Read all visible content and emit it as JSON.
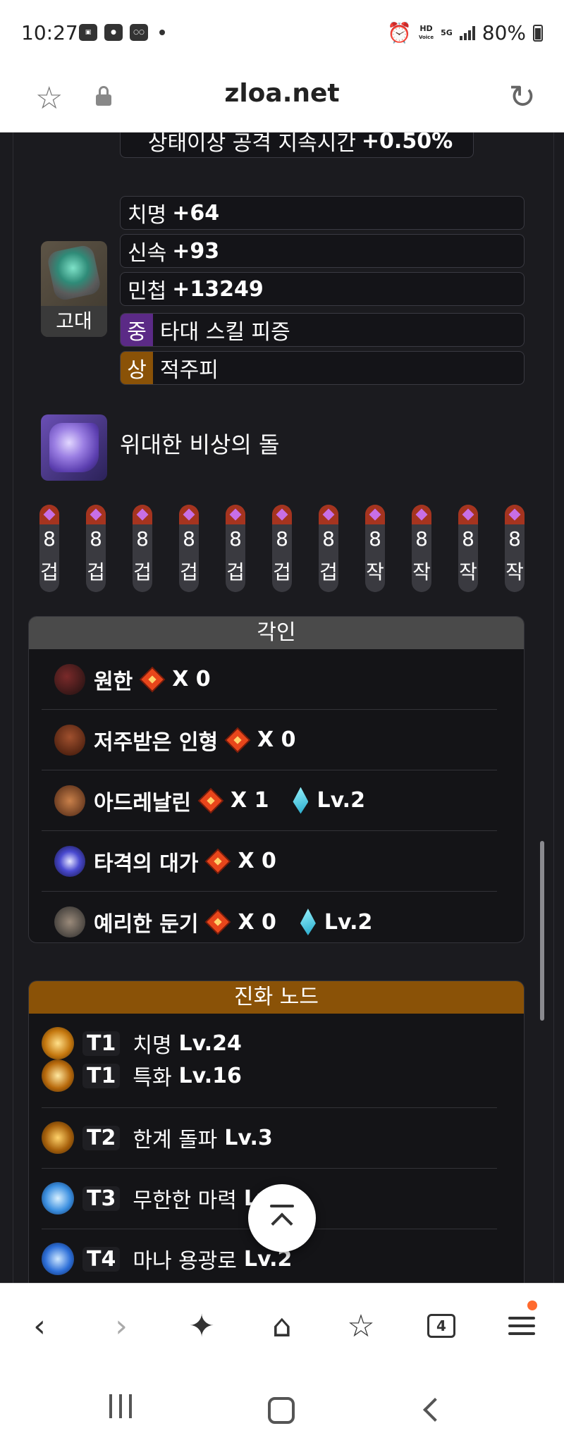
{
  "status_bar": {
    "time": "10:27",
    "battery": "80%",
    "hd_label": "HD",
    "voice_label": "Voice",
    "net_label": "5G"
  },
  "browser": {
    "domain": "zloa.net"
  },
  "top_partial": {
    "effect_label": "상태이상 공격 지속시간",
    "effect_value": "+0.50%"
  },
  "accessory": {
    "grade_label": "고대",
    "stats": [
      {
        "name": "치명",
        "value": "+64"
      },
      {
        "name": "신속",
        "value": "+93"
      },
      {
        "name": "민첩",
        "value": "+13249"
      }
    ],
    "options": [
      {
        "grade": "중",
        "text": "타대 스킬 피증",
        "color": "#5b2a86"
      },
      {
        "grade": "상",
        "text": "적주피",
        "color": "#8a5207"
      }
    ]
  },
  "ability_stone": {
    "name": "위대한 비상의 돌"
  },
  "gems": [
    {
      "level": "8",
      "kind": "겁"
    },
    {
      "level": "8",
      "kind": "겁"
    },
    {
      "level": "8",
      "kind": "겁"
    },
    {
      "level": "8",
      "kind": "겁"
    },
    {
      "level": "8",
      "kind": "겁"
    },
    {
      "level": "8",
      "kind": "겁"
    },
    {
      "level": "8",
      "kind": "겁"
    },
    {
      "level": "8",
      "kind": "작"
    },
    {
      "level": "8",
      "kind": "작"
    },
    {
      "level": "8",
      "kind": "작"
    },
    {
      "level": "8",
      "kind": "작"
    }
  ],
  "engravings": {
    "title": "각인",
    "items": [
      {
        "name": "원한",
        "count": "X 0",
        "stone_level": ""
      },
      {
        "name": "저주받은 인형",
        "count": "X 0",
        "stone_level": ""
      },
      {
        "name": "아드레날린",
        "count": "X 1",
        "stone_level": "Lv.2"
      },
      {
        "name": "타격의 대가",
        "count": "X 0",
        "stone_level": ""
      },
      {
        "name": "예리한 둔기",
        "count": "X 0",
        "stone_level": "Lv.2"
      }
    ]
  },
  "evolution": {
    "title": "진화 노드",
    "rows": [
      {
        "lines": [
          {
            "tier": "T1",
            "name": "치명",
            "level": "Lv.24"
          },
          {
            "tier": "T1",
            "name": "특화",
            "level": "Lv.16"
          }
        ]
      },
      {
        "lines": [
          {
            "tier": "T2",
            "name": "한계 돌파",
            "level": "Lv.3"
          }
        ]
      },
      {
        "lines": [
          {
            "tier": "T3",
            "name": "무한한 마력",
            "level": "Lv."
          }
        ]
      },
      {
        "lines": [
          {
            "tier": "T4",
            "name": "마나 용광로",
            "level": "Lv.2"
          }
        ]
      }
    ]
  },
  "toolbar": {
    "tab_count": "4"
  },
  "colors": {
    "background": "#1b1b1f",
    "engraving_header": "#4a4a4a",
    "evolution_header": "#8a5207",
    "relic": "#e8461b",
    "gem_top": "#a5341f"
  },
  "icons": [
    "star-icon",
    "lock-icon",
    "reload-icon",
    "back-icon",
    "forward-icon",
    "sparkle-icon",
    "home-icon",
    "bookmarks-icon",
    "tabs-icon",
    "menu-icon",
    "scroll-top-icon"
  ]
}
